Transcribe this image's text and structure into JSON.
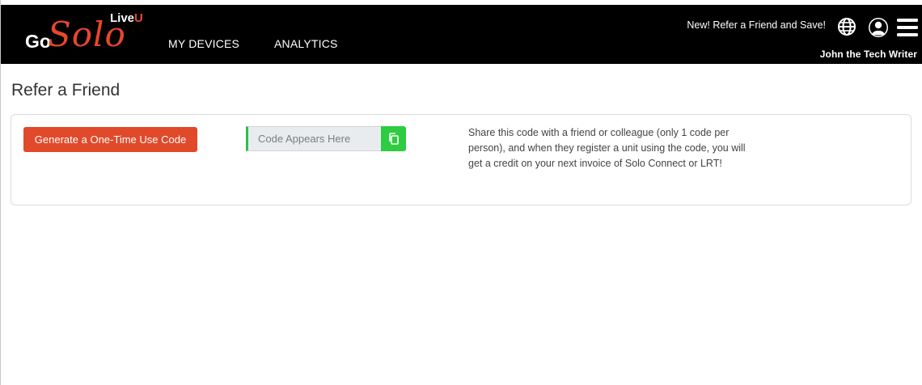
{
  "header": {
    "logo": {
      "go": "Go",
      "solo": "Solo",
      "live": "Live",
      "u": "U"
    },
    "nav": {
      "devices_label": "MY DEVICES",
      "analytics_label": "ANALYTICS"
    },
    "promo_text": "New! Refer a Friend and Save!",
    "user_name": "John the Tech Writer",
    "icons": [
      "globe-icon",
      "user-icon",
      "hamburger-menu-icon"
    ]
  },
  "main": {
    "title": "Refer a Friend",
    "generate_button_label": "Generate a One-Time Use Code",
    "code_input": {
      "placeholder": "Code Appears Here",
      "value": ""
    },
    "copy_icon": "copy-icon",
    "description": "Share this code with a friend or colleague (only 1 code per person), and when they register a unit using the code, you will get a credit on your next invoice of Solo Connect or LRT!"
  },
  "colors": {
    "header_bg": "#000000",
    "brand_orange": "#e04a2a",
    "copy_green": "#2ecc40",
    "input_accent": "#2fbf46"
  }
}
